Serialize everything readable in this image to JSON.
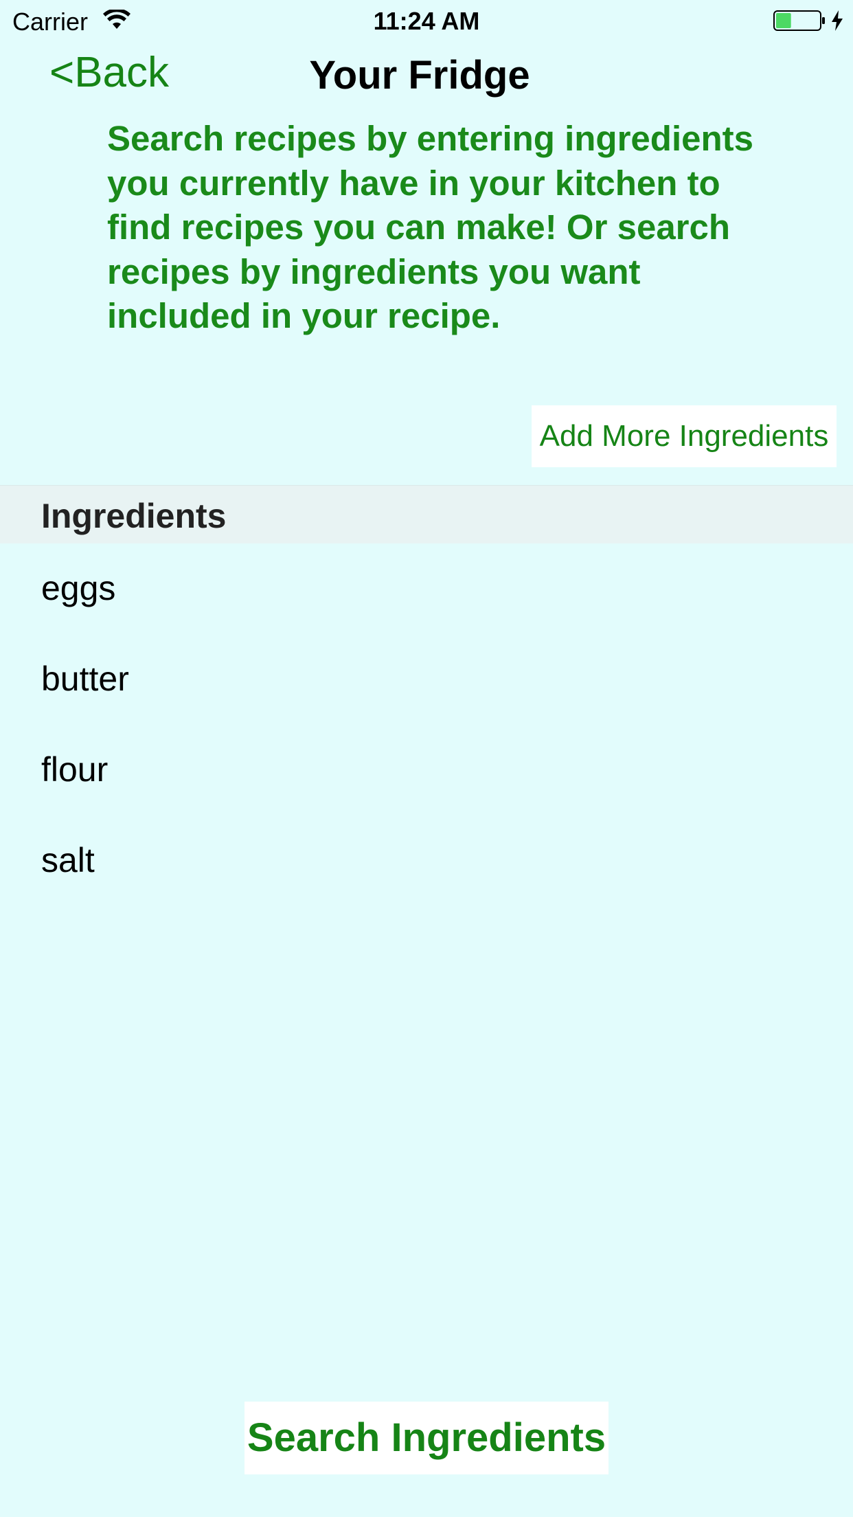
{
  "status_bar": {
    "carrier": "Carrier",
    "time": "11:24 AM",
    "battery_level": 0.35,
    "charging": true,
    "icons": [
      "wifi-icon",
      "battery-icon",
      "charging-bolt-icon"
    ]
  },
  "nav": {
    "back_label": "<Back",
    "title": "Your Fridge"
  },
  "description": "Search recipes by entering ingredients you currently have in your kitchen to find recipes you can make! Or search recipes by ingredients you want included in your recipe.",
  "add_more_button": "Add More Ingredients",
  "ingredients": {
    "header": "Ingredients",
    "items": [
      "eggs",
      "butter",
      "flour",
      "salt"
    ]
  },
  "search_button": "Search Ingredients",
  "colors": {
    "background": "#e2fcfc",
    "accent_green": "#168416",
    "button_background": "#ffffff",
    "section_header_background": "#e8f3f3",
    "battery_fill": "#4cd964"
  }
}
